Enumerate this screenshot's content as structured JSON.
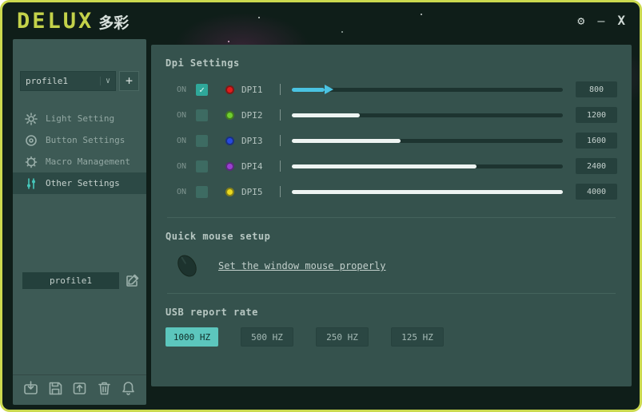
{
  "theme": {
    "border": "#cbd94f",
    "accent": "#45c6ba",
    "panel": "#35524d",
    "sidebar": "#3d5a55"
  },
  "titlebar": {
    "logo": "DELUX",
    "logo_cn": "多彩",
    "controls": {
      "settings_glyph": "⚙",
      "minimize_glyph": "—",
      "close_glyph": "X"
    }
  },
  "sidebar": {
    "profile_select": {
      "value": "profile1",
      "chevron": "∨"
    },
    "add_label": "+",
    "items": [
      {
        "label": "Light Setting",
        "active": false
      },
      {
        "label": "Button Settings",
        "active": false
      },
      {
        "label": "Macro Management",
        "active": false
      },
      {
        "label": "Other Settings",
        "active": true
      }
    ],
    "profile_label": "profile1"
  },
  "main": {
    "dpi": {
      "title": "Dpi Settings",
      "on_label": "ON",
      "rows": [
        {
          "name": "DPI1",
          "value": "800",
          "percent": 12,
          "dot_color": "#e31b1b",
          "fill_color": "#4ac3e2",
          "checked": true,
          "has_handle": true
        },
        {
          "name": "DPI2",
          "value": "1200",
          "percent": 25,
          "dot_color": "#6fce2e",
          "fill_color": "#eef4f2",
          "checked": false,
          "has_handle": false
        },
        {
          "name": "DPI3",
          "value": "1600",
          "percent": 40,
          "dot_color": "#2749e0",
          "fill_color": "#eef4f2",
          "checked": false,
          "has_handle": false
        },
        {
          "name": "DPI4",
          "value": "2400",
          "percent": 68,
          "dot_color": "#9a3fd1",
          "fill_color": "#eef4f2",
          "checked": false,
          "has_handle": false
        },
        {
          "name": "DPI5",
          "value": "4000",
          "percent": 100,
          "dot_color": "#ead91f",
          "fill_color": "#eef4f2",
          "checked": false,
          "has_handle": false
        }
      ]
    },
    "quick": {
      "title": "Quick mouse setup",
      "link": "Set the window mouse properly"
    },
    "usb": {
      "title": "USB report rate",
      "options": [
        {
          "label": "1000 HZ",
          "active": true
        },
        {
          "label": "500 HZ",
          "active": false
        },
        {
          "label": "250 HZ",
          "active": false
        },
        {
          "label": "125 HZ",
          "active": false
        }
      ]
    }
  }
}
